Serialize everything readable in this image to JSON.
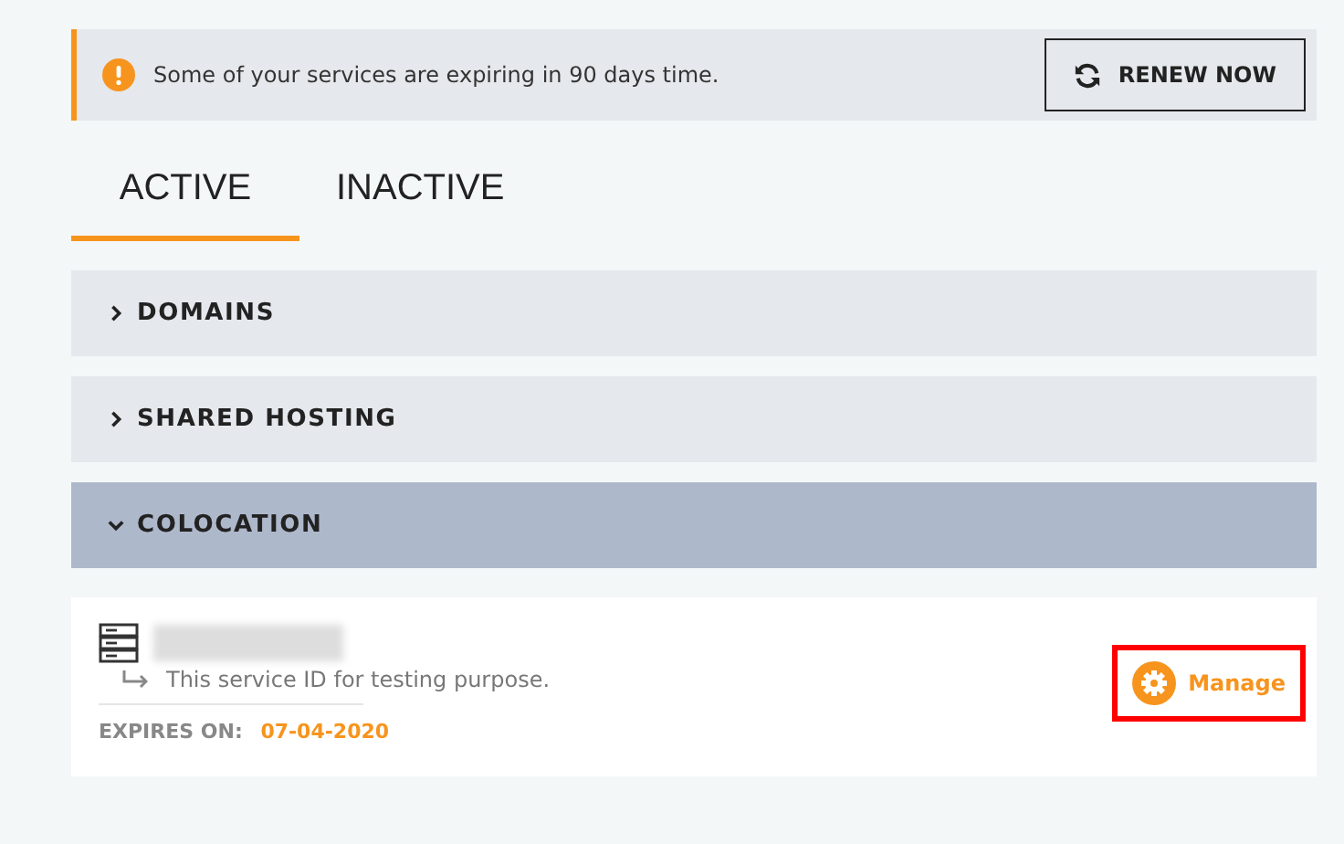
{
  "alert": {
    "message": "Some of your services are expiring in 90 days time.",
    "button": "RENEW NOW"
  },
  "tabs": [
    {
      "label": "ACTIVE",
      "selected": true
    },
    {
      "label": "INACTIVE",
      "selected": false
    }
  ],
  "sections": [
    {
      "title": "DOMAINS",
      "expanded": false
    },
    {
      "title": "SHARED HOSTING",
      "expanded": false
    },
    {
      "title": "COLOCATION",
      "expanded": true
    }
  ],
  "service": {
    "description": "This service ID for testing purpose.",
    "expires_label": "EXPIRES ON:",
    "expires_date": "07-04-2020",
    "action": "Manage"
  }
}
